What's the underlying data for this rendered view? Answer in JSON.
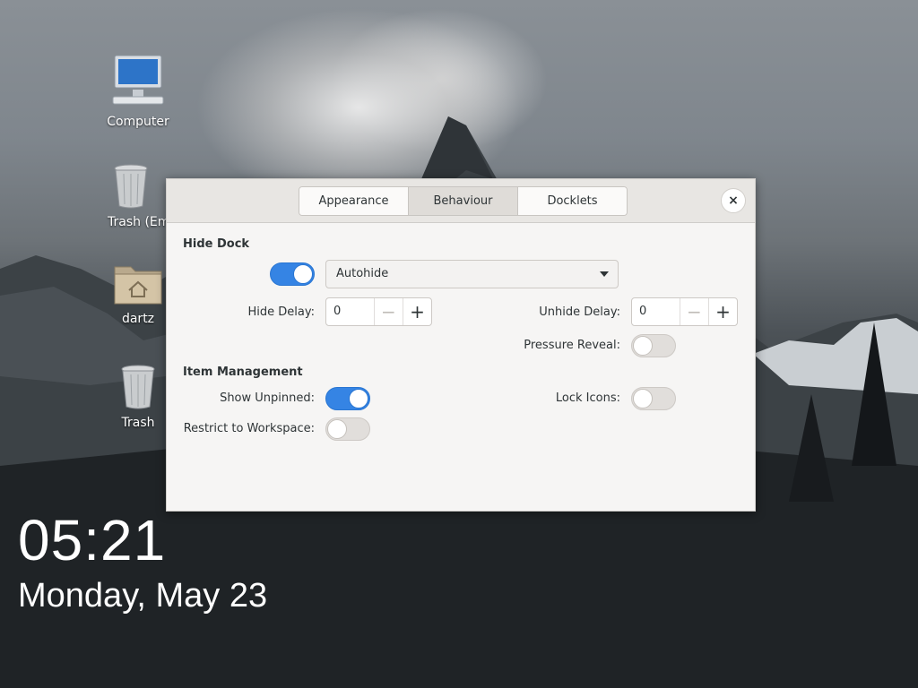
{
  "desktop": {
    "icons": [
      {
        "label": "Computer"
      },
      {
        "label": "Trash (Empty)"
      },
      {
        "label": "dartz"
      },
      {
        "label": "Trash"
      }
    ],
    "clock": "05:21",
    "date": "Monday, May 23"
  },
  "dialog": {
    "tabs": [
      "Appearance",
      "Behaviour",
      "Docklets"
    ],
    "active_tab": "Behaviour",
    "close_icon": "×",
    "hide_dock": {
      "title": "Hide Dock",
      "enabled": true,
      "mode": "Autohide",
      "hide_delay_label": "Hide Delay:",
      "hide_delay": "0",
      "unhide_delay_label": "Unhide Delay:",
      "unhide_delay": "0",
      "pressure_reveal_label": "Pressure Reveal:",
      "pressure_reveal": false
    },
    "item_management": {
      "title": "Item Management",
      "show_unpinned_label": "Show Unpinned:",
      "show_unpinned": true,
      "lock_icons_label": "Lock Icons:",
      "lock_icons": false,
      "restrict_label": "Restrict to Workspace:",
      "restrict": false
    },
    "spin_minus": "−",
    "spin_plus": "+"
  },
  "colors": {
    "accent": "#3584e4",
    "window_bg": "#f6f5f4",
    "header_bg": "#e8e6e3"
  }
}
